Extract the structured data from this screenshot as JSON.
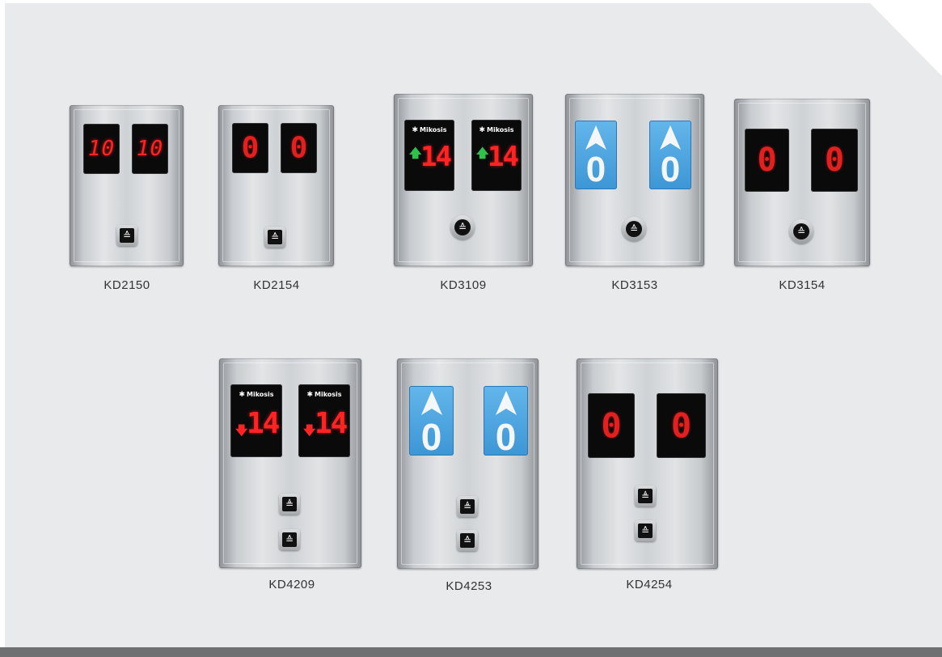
{
  "brand_text": "Mikosis",
  "icons": {
    "down_button": "chevron-double-down-icon",
    "up_button": "chevron-double-up-icon",
    "direction_up": "green-up-arrow-icon",
    "direction_down": "red-down-arrow-icon",
    "blue_direction": "white-up-arrowhead-icon"
  },
  "colors": {
    "background": "#e9eaec",
    "segment_red": "#ff2424",
    "display_blue": "#3d96d5",
    "green_arrow": "#2fc24a"
  },
  "products": [
    {
      "model": "KD2150",
      "displays": [
        "10",
        "10"
      ]
    },
    {
      "model": "KD2154",
      "displays": [
        "0",
        "0"
      ]
    },
    {
      "model": "KD3109",
      "displays": [
        "14",
        "14"
      ]
    },
    {
      "model": "KD3153",
      "displays": [
        "0",
        "0"
      ]
    },
    {
      "model": "KD3154",
      "displays": [
        "0",
        "0"
      ]
    },
    {
      "model": "KD4209",
      "displays": [
        "14",
        "14"
      ]
    },
    {
      "model": "KD4253",
      "displays": [
        "0",
        "0"
      ]
    },
    {
      "model": "KD4254",
      "displays": [
        "0",
        "0"
      ]
    }
  ]
}
